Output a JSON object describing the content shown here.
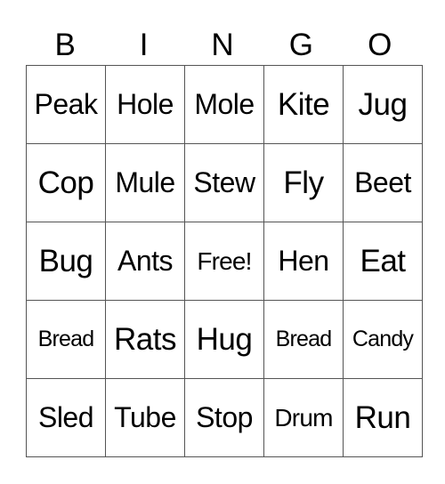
{
  "card": {
    "header": [
      "B",
      "I",
      "N",
      "G",
      "O"
    ],
    "rows": [
      [
        "Peak",
        "Hole",
        "Mole",
        "Kite",
        "Jug"
      ],
      [
        "Cop",
        "Mule",
        "Stew",
        "Fly",
        "Beet"
      ],
      [
        "Bug",
        "Ants",
        "Free!",
        "Hen",
        "Eat"
      ],
      [
        "Bread",
        "Rats",
        "Hug",
        "Bread",
        "Candy"
      ],
      [
        "Sled",
        "Tube",
        "Stop",
        "Drum",
        "Run"
      ]
    ]
  }
}
